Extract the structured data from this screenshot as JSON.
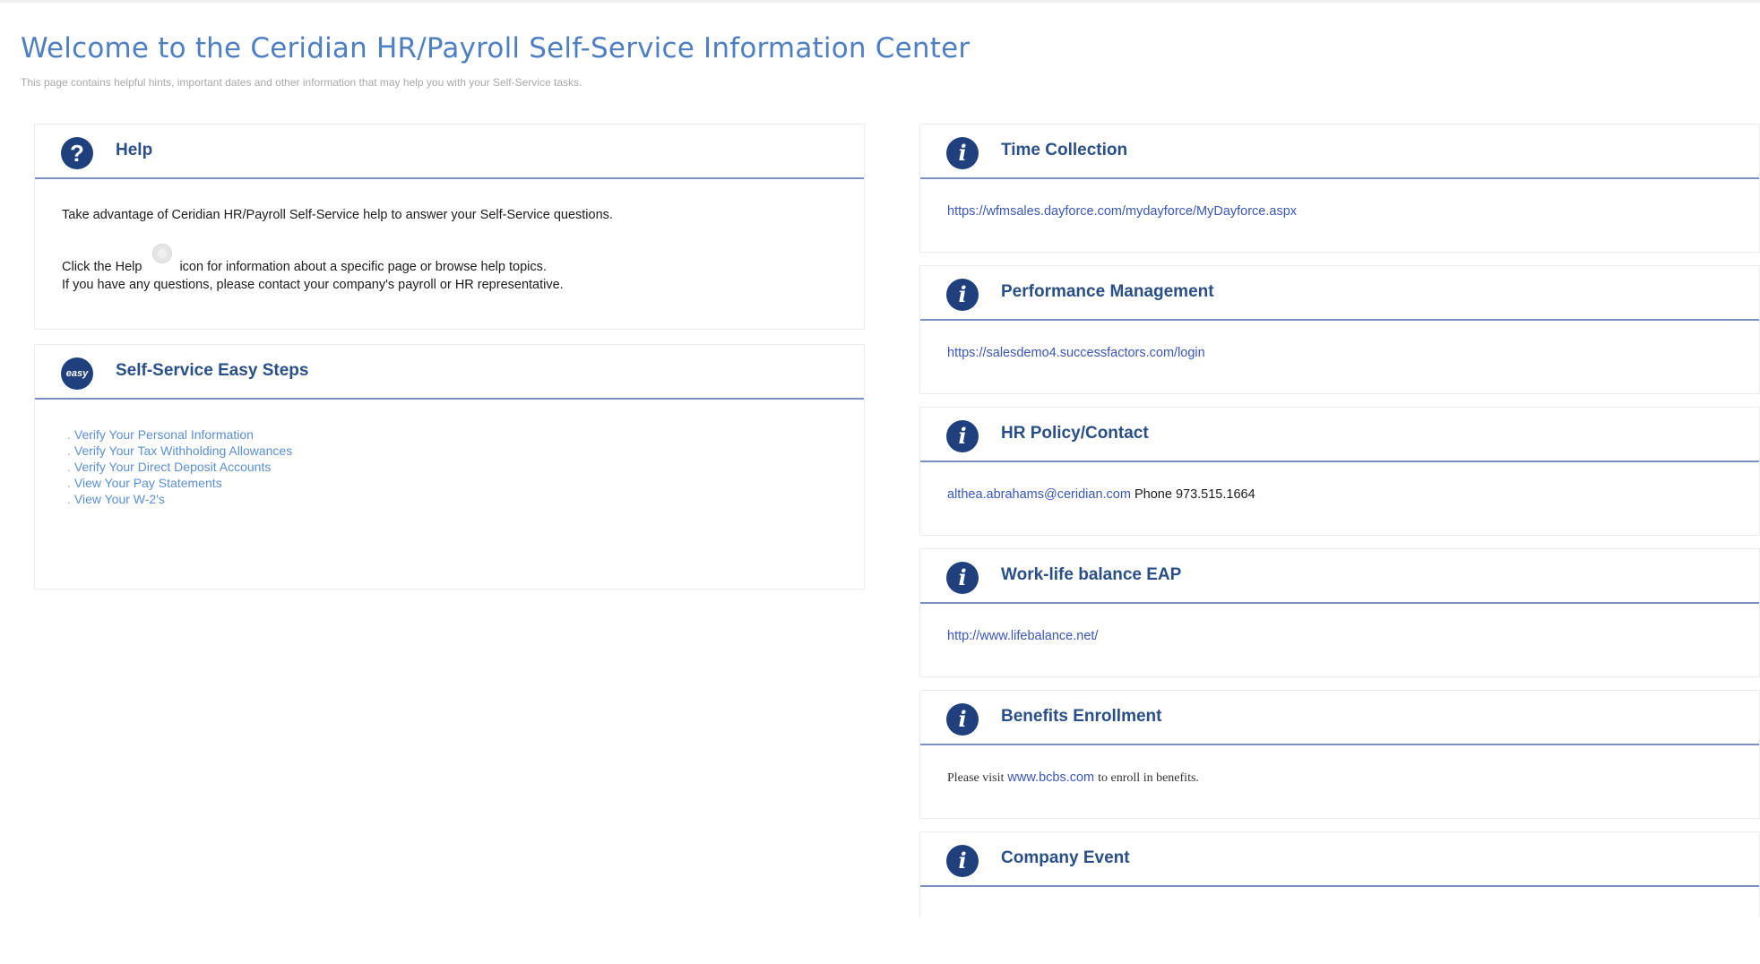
{
  "header": {
    "title": "Welcome to the Ceridian HR/Payroll Self-Service Information Center",
    "subtitle": "This page contains helpful hints, important dates and other information that may help you with your Self-Service tasks."
  },
  "help": {
    "title": "Help",
    "icon": "question-icon",
    "line1": "Take advantage of Ceridian HR/Payroll Self-Service help to answer your Self-Service questions.",
    "line2_before": "Click the Help",
    "line2_after": "icon for information about a specific page or browse help topics.",
    "line3": "If you have any questions, please contact your company's payroll or HR representative."
  },
  "easy_steps": {
    "title": "Self-Service Easy Steps",
    "icon_text": "easy",
    "items": [
      {
        "label": "Verify Your Personal Information"
      },
      {
        "label": "Verify Your Tax Withholding Allowances"
      },
      {
        "label": "Verify Your Direct Deposit Accounts"
      },
      {
        "label": "View Your Pay Statements"
      },
      {
        "label": "View Your W-2's"
      }
    ]
  },
  "right_panels": {
    "time_collection": {
      "title": "Time Collection",
      "link": "https://wfmsales.dayforce.com/mydayforce/MyDayforce.aspx"
    },
    "performance": {
      "title": "Performance Management",
      "link": "https://salesdemo4.successfactors.com/login"
    },
    "hr_policy": {
      "title": "HR Policy/Contact",
      "email": "althea.abrahams@ceridian.com",
      "phone_label": "Phone",
      "phone": "973.515.1664"
    },
    "work_life": {
      "title": "Work-life balance EAP",
      "link": "http://www.lifebalance.net/"
    },
    "benefits": {
      "title": "Benefits Enrollment",
      "text_before": "Please visit",
      "link": "www.bcbs.com",
      "text_after": "to enroll in benefits."
    },
    "company_event": {
      "title": "Company Event"
    }
  },
  "colors": {
    "title_blue": "#4f7fc3",
    "header_text": "#2a4f86",
    "icon_navy": "#1f3f7d",
    "divider": "#7d8fc4",
    "link": "#3a57b8"
  }
}
